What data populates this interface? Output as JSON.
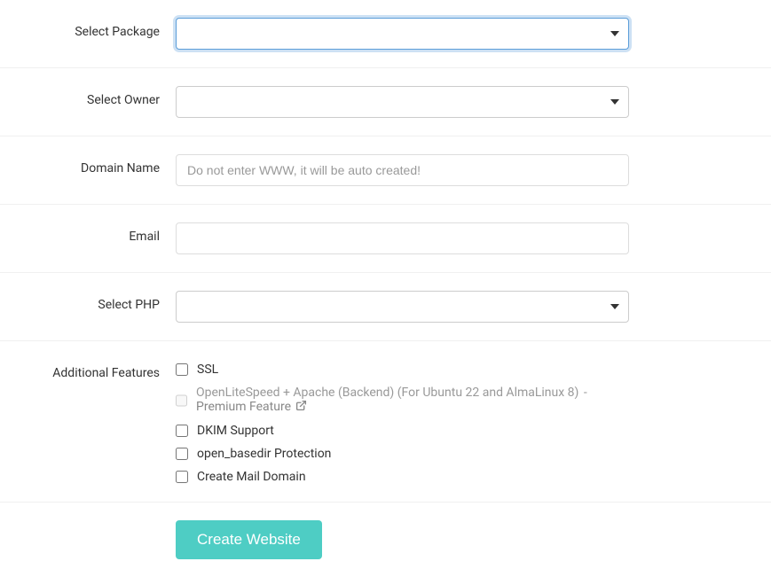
{
  "form": {
    "package": {
      "label": "Select Package",
      "value": ""
    },
    "owner": {
      "label": "Select Owner",
      "value": ""
    },
    "domain": {
      "label": "Domain Name",
      "value": "",
      "placeholder": "Do not enter WWW, it will be auto created!"
    },
    "email": {
      "label": "Email",
      "value": ""
    },
    "php": {
      "label": "Select PHP",
      "value": ""
    },
    "features": {
      "label": "Additional Features",
      "ssl": {
        "label": "SSL"
      },
      "ols_apache": {
        "label": "OpenLiteSpeed + Apache (Backend) (For Ubuntu 22 and AlmaLinux 8)",
        "premium_label": "Premium Feature",
        "separator": "-"
      },
      "dkim": {
        "label": "DKIM Support"
      },
      "open_basedir": {
        "label": "open_basedir Protection"
      },
      "mail_domain": {
        "label": "Create Mail Domain"
      }
    },
    "submit": {
      "label": "Create Website"
    }
  }
}
